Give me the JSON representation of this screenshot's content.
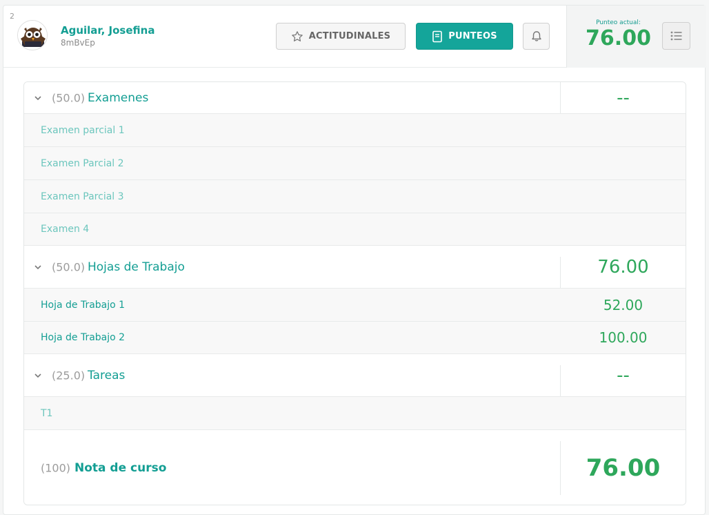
{
  "header": {
    "index": "2",
    "student_name": "Aguilar, Josefina",
    "student_code": "8mBvEp",
    "actitudinales_label": "ACTITUDINALES",
    "punteos_label": "PUNTEOS",
    "current_label": "Punteo actual:",
    "current_value": "76.00",
    "icons": {
      "star": "star-icon",
      "book": "book-icon",
      "bell": "bell-icon",
      "list": "list-icon"
    }
  },
  "categories": [
    {
      "weight": "(50.0)",
      "name": "Examenes",
      "score": "--",
      "items": [
        {
          "name": "Examen parcial 1",
          "score": ""
        },
        {
          "name": "Examen Parcial 2",
          "score": ""
        },
        {
          "name": "Examen Parcial 3",
          "score": ""
        },
        {
          "name": "Examen 4",
          "score": ""
        }
      ]
    },
    {
      "weight": "(50.0)",
      "name": "Hojas de Trabajo",
      "score": "76.00",
      "items": [
        {
          "name": "Hoja de Trabajo 1",
          "score": "52.00"
        },
        {
          "name": "Hoja de Trabajo 2",
          "score": "100.00"
        }
      ]
    },
    {
      "weight": "(25.0)",
      "name": "Tareas",
      "score": "--",
      "items": [
        {
          "name": "T1",
          "score": ""
        }
      ]
    }
  ],
  "total": {
    "weight": "(100)",
    "name": "Nota de curso",
    "score": "76.00"
  },
  "colors": {
    "primary": "#14a59a",
    "score_green": "#2ea75b",
    "muted_teal": "#6cc6bd"
  }
}
